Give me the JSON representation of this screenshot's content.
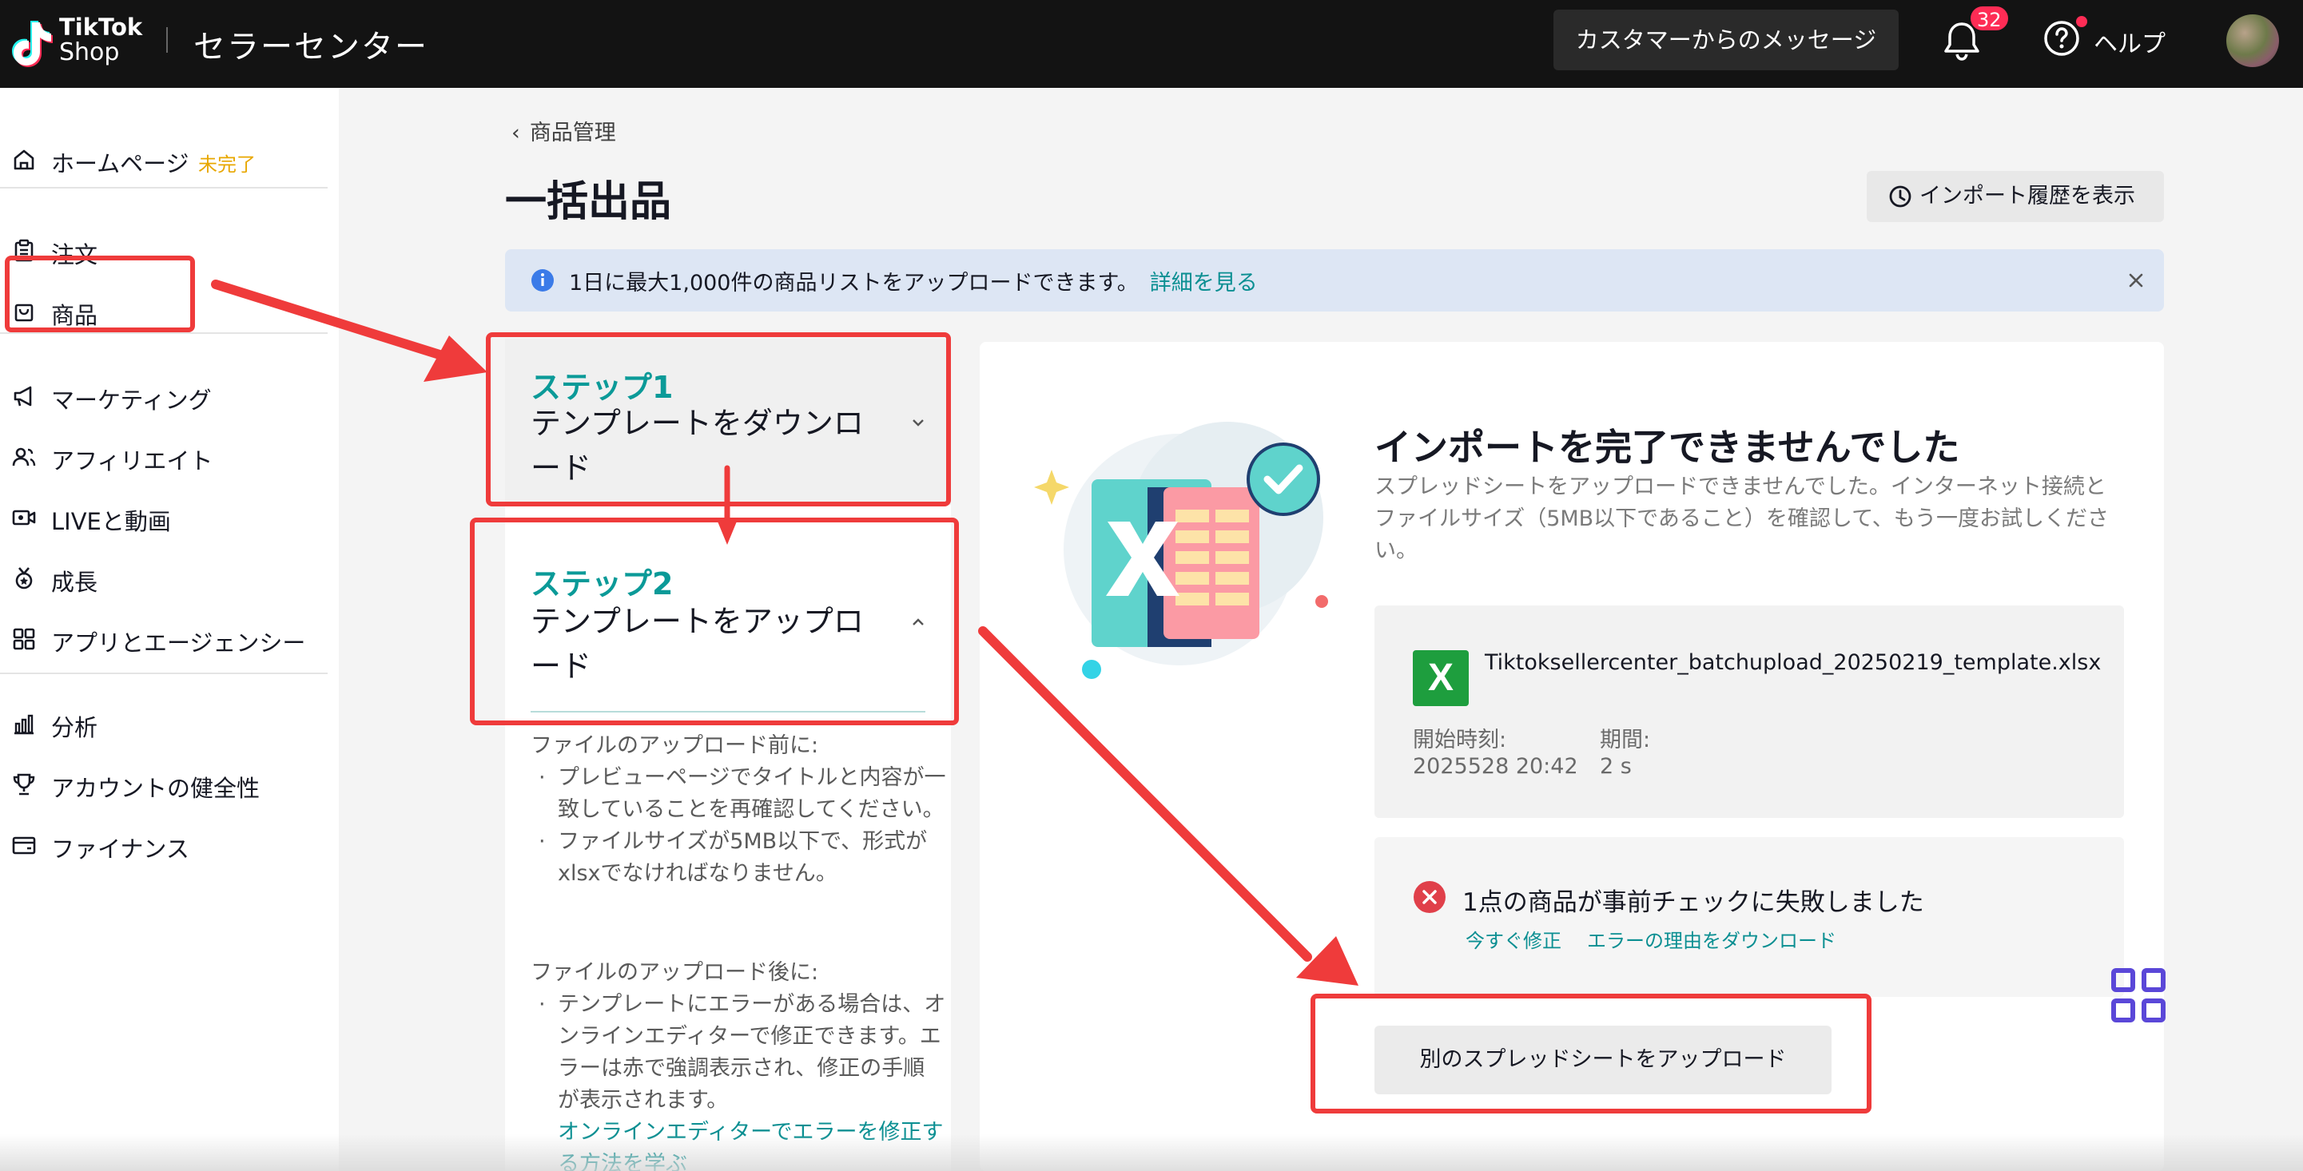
{
  "header": {
    "logo_line1": "TikTok",
    "logo_line2": "Shop",
    "app_title": "セラーセンター",
    "message_button": "カスタマーからのメッセージ",
    "notification_count": "32",
    "help_label": "ヘルプ"
  },
  "sidebar": {
    "items": [
      {
        "label": "ホームページ",
        "badge": "未完了",
        "icon": "home-icon"
      },
      {
        "label": "注文",
        "icon": "clipboard-icon"
      },
      {
        "label": "商品",
        "icon": "bag-icon"
      },
      {
        "label": "マーケティング",
        "icon": "megaphone-icon"
      },
      {
        "label": "アフィリエイト",
        "icon": "people-icon"
      },
      {
        "label": "LIVEと動画",
        "icon": "video-icon"
      },
      {
        "label": "成長",
        "icon": "medal-icon"
      },
      {
        "label": "アプリとエージェンシー",
        "icon": "apps-icon"
      },
      {
        "label": "分析",
        "icon": "chart-icon"
      },
      {
        "label": "アカウントの健全性",
        "icon": "trophy-icon"
      },
      {
        "label": "ファイナンス",
        "icon": "wallet-icon"
      }
    ]
  },
  "main": {
    "breadcrumb": "商品管理",
    "page_title": "一括出品",
    "history_button": "インポート履歴を表示",
    "banner": {
      "text": "1日に最大1,000件の商品リストをアップロードできます。",
      "link": "詳細を見る"
    },
    "steps": [
      {
        "head": "ステップ1",
        "title": "テンプレートをダウンロード"
      },
      {
        "head": "ステップ2",
        "title": "テンプレートをアップロード"
      }
    ],
    "before_upload": {
      "heading": "ファイルのアップロード前に:",
      "bullets": [
        "プレビューページでタイトルと内容が一致していることを再確認してください。",
        "ファイルサイズが5MB以下で、形式がxlsxでなければなりません。"
      ]
    },
    "after_upload": {
      "heading": "ファイルのアップロード後に:",
      "bullets": [
        "テンプレートにエラーがある場合は、オンラインエディターで修正できます。エラーは赤で強調表示され、修正の手順が表示されます。"
      ],
      "link": "オンラインエディターでエラーを修正する方法を学ぶ"
    },
    "result": {
      "title": "インポートを完了できませんでした",
      "description": "スプレッドシートをアップロードできませんでした。インターネット接続とファイルサイズ（5MB以下であること）を確認して、もう一度お試しください。",
      "file_name": "Tiktoksellercenter_batchupload_20250219_template.xlsx",
      "start_label": "開始時刻:",
      "start_value": "2025528 20:42",
      "duration_label": "期間:",
      "duration_value": "2 s",
      "error_text": "1点の商品が事前チェックに失敗しました",
      "fix_link": "今すぐ修正",
      "download_link": "エラーの理由をダウンロード",
      "upload_button": "別のスプレッドシートをアップロード"
    }
  },
  "colors": {
    "accent": "#0b9a98",
    "annotation": "#ef3b3b",
    "error": "#e0404a",
    "badge": "#fe2c55"
  }
}
